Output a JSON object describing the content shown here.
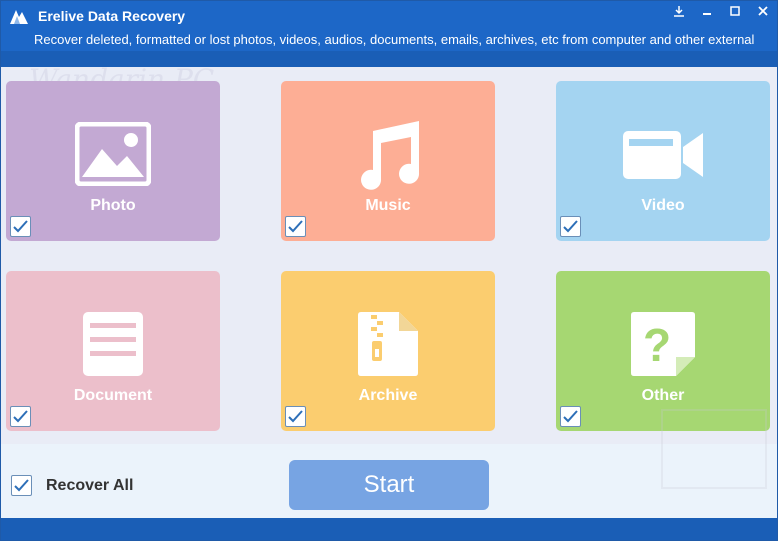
{
  "window": {
    "title": "Erelive Data Recovery",
    "subtitle": "Recover deleted, formatted or lost photos, videos, audios, documents, emails, archives, etc from computer and other external",
    "controls": [
      "download-icon",
      "minimize-icon",
      "maximize-icon",
      "close-icon"
    ]
  },
  "watermark": {
    "text": "Wandarin PC"
  },
  "tiles": [
    {
      "label": "Photo",
      "color": "#c3a9d3",
      "icon": "image-icon",
      "checked": true
    },
    {
      "label": "Music",
      "color": "#fdae95",
      "icon": "music-note-icon",
      "checked": true
    },
    {
      "label": "Video",
      "color": "#a4d4f1",
      "icon": "video-camera-icon",
      "checked": true
    },
    {
      "label": "Document",
      "color": "#ecbfcb",
      "icon": "document-icon",
      "checked": true
    },
    {
      "label": "Archive",
      "color": "#fbcd6f",
      "icon": "zip-file-icon",
      "checked": true
    },
    {
      "label": "Other",
      "color": "#a6d772",
      "icon": "question-file-icon",
      "checked": true
    }
  ],
  "footer": {
    "recover_all_label": "Recover All",
    "recover_all_checked": true,
    "start_label": "Start"
  },
  "colors": {
    "titlebar": "#1d67c7",
    "start_button": "#77a4e3",
    "footer_bg": "#ebf3fb"
  }
}
